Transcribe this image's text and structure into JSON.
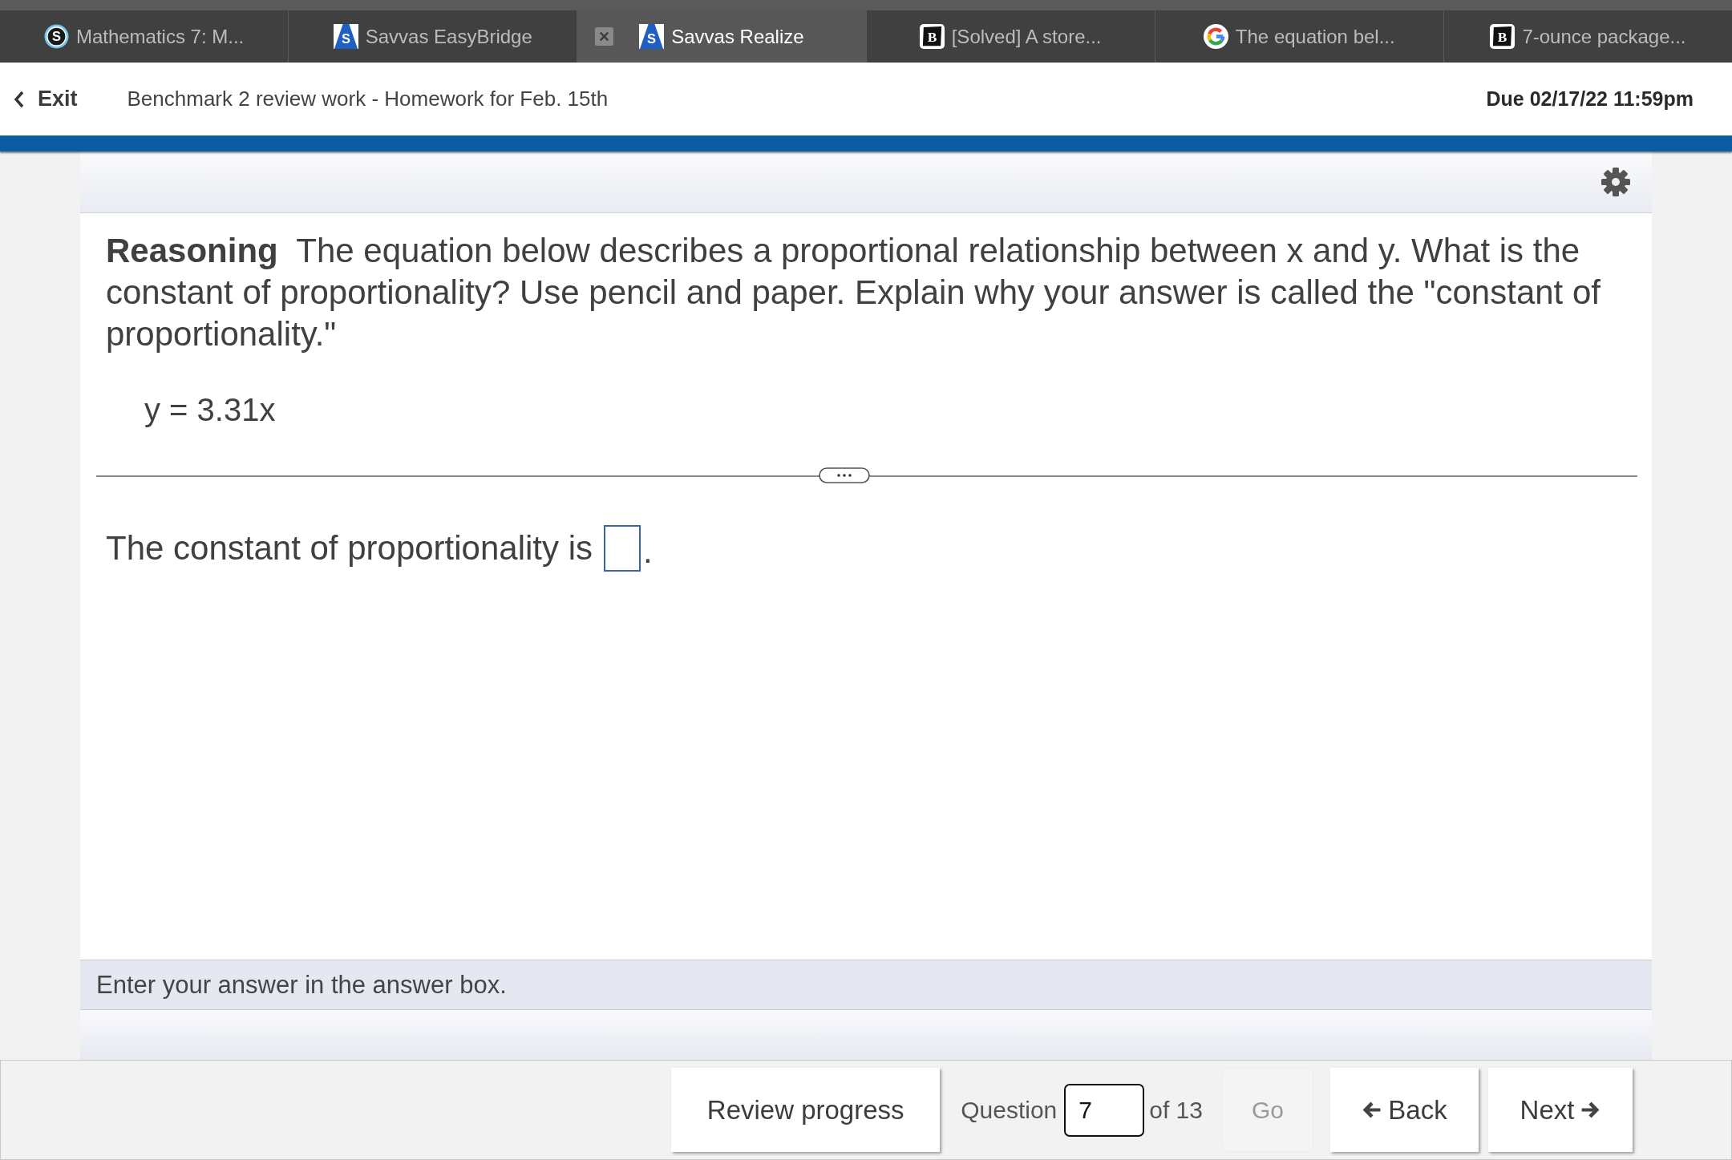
{
  "browser_tabs": [
    {
      "title": "Mathematics 7: M...",
      "kind": "circle",
      "icon_letter": "S",
      "selected": false
    },
    {
      "title": "Savvas EasyBridge",
      "kind": "triangle",
      "icon_letter": "S",
      "selected": false
    },
    {
      "title": "Savvas Realize",
      "kind": "triangle",
      "icon_letter": "S",
      "selected": true
    },
    {
      "title": "[Solved] A store...",
      "kind": "square",
      "icon_letter": "B",
      "selected": false
    },
    {
      "title": "The equation bel...",
      "kind": "google",
      "selected": false
    },
    {
      "title": "7-ounce package...",
      "kind": "square",
      "icon_letter": "B",
      "selected": false
    }
  ],
  "header": {
    "exit_label": "Exit",
    "assignment_title": "Benchmark 2 review work - Homework for Feb. 15th",
    "due": "Due 02/17/22 11:59pm"
  },
  "question": {
    "prompt": "**Reasoning**  The equation below describes a proportional relationship between x and y. What is the constant of proportionality? Use pencil and paper. Explain why your answer is called the \"constant of proportionality.\"",
    "equation": "y = 3.31x",
    "answer_text": "The constant of proportionality is",
    "answer_end": "."
  },
  "hint": "Enter your answer in the answer box.",
  "footer": {
    "review_button": "Review progress",
    "question_label": "Question",
    "question_number": "7",
    "question_total": "of 13",
    "go_button": {
      "label": "Go",
      "disabled": true
    },
    "back_button": "Back",
    "next_button": "Next"
  }
}
